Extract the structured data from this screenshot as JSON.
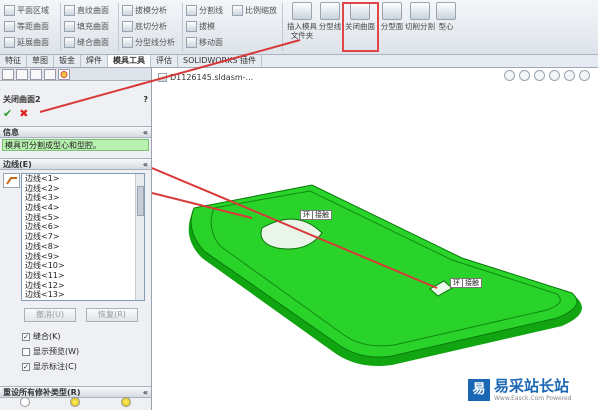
{
  "ribbon": {
    "col1": [
      "平面区域",
      "等距曲面",
      "延展曲面"
    ],
    "col2": [
      "直纹曲面",
      "填充曲面",
      "缝合曲面"
    ],
    "col3": [
      "拔模分析",
      "底切分析",
      "分型线分析"
    ],
    "col4": [
      "分割线",
      "拔模",
      "移动面"
    ],
    "col5": [
      "比例缩放"
    ],
    "big": [
      "插入模具文件夹",
      "分型线",
      "关闭曲面",
      "分型面",
      "切削分割",
      "型心"
    ]
  },
  "tabs": [
    "特征",
    "草图",
    "钣金",
    "焊件",
    "模具工具",
    "评估",
    "SOLIDWORKS 插件"
  ],
  "active_tab": "模具工具",
  "panel": {
    "title": "关闭曲面2",
    "help": "?",
    "ok": "✔",
    "cancel": "✖",
    "info_header": "信息",
    "info_text": "模具可分割成型心和型腔。",
    "edges_header": "边线(E)",
    "edges": [
      "边线<1>",
      "边线<2>",
      "边线<3>",
      "边线<4>",
      "边线<5>",
      "边线<6>",
      "边线<7>",
      "边线<8>",
      "边线<9>",
      "边线<10>",
      "边线<11>",
      "边线<12>",
      "边线<13>"
    ],
    "undo": "撤消(U)",
    "redo": "恢复(R)",
    "options": [
      {
        "label": "缝合(K)",
        "checked": true
      },
      {
        "label": "显示预览(W)",
        "checked": false
      },
      {
        "label": "显示标注(C)",
        "checked": true
      }
    ],
    "reset_header": "重设所有修补类型(R)"
  },
  "viewport": {
    "filename": "D1126145.sldasm-...",
    "callout1": [
      "环",
      "接触"
    ],
    "callout2": [
      "环",
      "接触"
    ]
  },
  "watermark": {
    "logo": "易",
    "title": "易采站长站",
    "url": "Www.Easck.Com Powered"
  },
  "colors": {
    "part": "#22c022",
    "callout_arrow": "#d83a3a",
    "info_bg": "#b8f0b0"
  }
}
